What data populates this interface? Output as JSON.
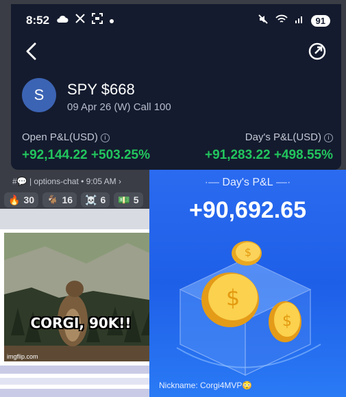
{
  "phone": {
    "time": "8:52",
    "battery": "91",
    "avatar_letter": "S",
    "title": "SPY $668",
    "subtitle": "09 Apr 26 (W) Call 100",
    "open_pl_label": "Open P&L(USD)",
    "open_pl_value": "+92,144.22 +503.25%",
    "day_pl_label": "Day's P&L(USD)",
    "day_pl_value": "+91,283.22 +498.55%",
    "gain_color": "#22c55e"
  },
  "discord": {
    "channel_meta": "#💬 | options-chat • 9:05 AM ›",
    "reactions": [
      {
        "emoji": "🔥",
        "count": "30"
      },
      {
        "emoji": "🐐",
        "count": "16"
      },
      {
        "emoji": "☠️",
        "count": "6"
      },
      {
        "emoji": "💵",
        "count": "5"
      }
    ]
  },
  "meme": {
    "caption": "CORGI, 90K!!",
    "credit": "imgflip.com"
  },
  "pnl_card": {
    "label": "Day's P&L",
    "value": "+90,692.65",
    "nickname": "Nickname: Corgi4MVP😳",
    "bg_color": "#1e5fe8"
  }
}
